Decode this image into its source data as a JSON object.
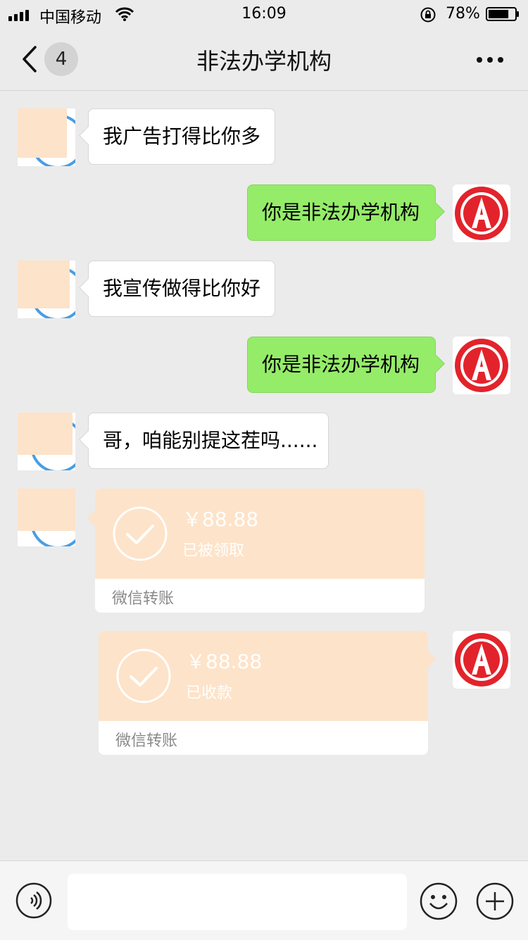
{
  "status_bar": {
    "carrier": "中国移动",
    "time": "16:09",
    "battery_percent": "78%",
    "battery_level": 0.78
  },
  "nav": {
    "unread_count": "4",
    "title": "非法办学机构"
  },
  "messages": [
    {
      "side": "left",
      "text": "我广告打得比你多"
    },
    {
      "side": "right",
      "text": "你是非法办学机构"
    },
    {
      "side": "left",
      "text": "我宣传做得比你好"
    },
    {
      "side": "right",
      "text": "你是非法办学机构"
    },
    {
      "side": "left",
      "text": "哥，咱能别提这茬吗......"
    }
  ],
  "transfers": [
    {
      "side": "left",
      "amount": "￥88.88",
      "status": "已被领取",
      "label": "微信转账"
    },
    {
      "side": "right",
      "amount": "￥88.88",
      "status": "已收款",
      "label": "微信转账"
    }
  ],
  "colors": {
    "background": "#ebebeb",
    "bubble_right": "#95ec69",
    "bubble_left": "#ffffff",
    "transfer": "#fde3c9",
    "avatar_red": "#e3232b"
  }
}
